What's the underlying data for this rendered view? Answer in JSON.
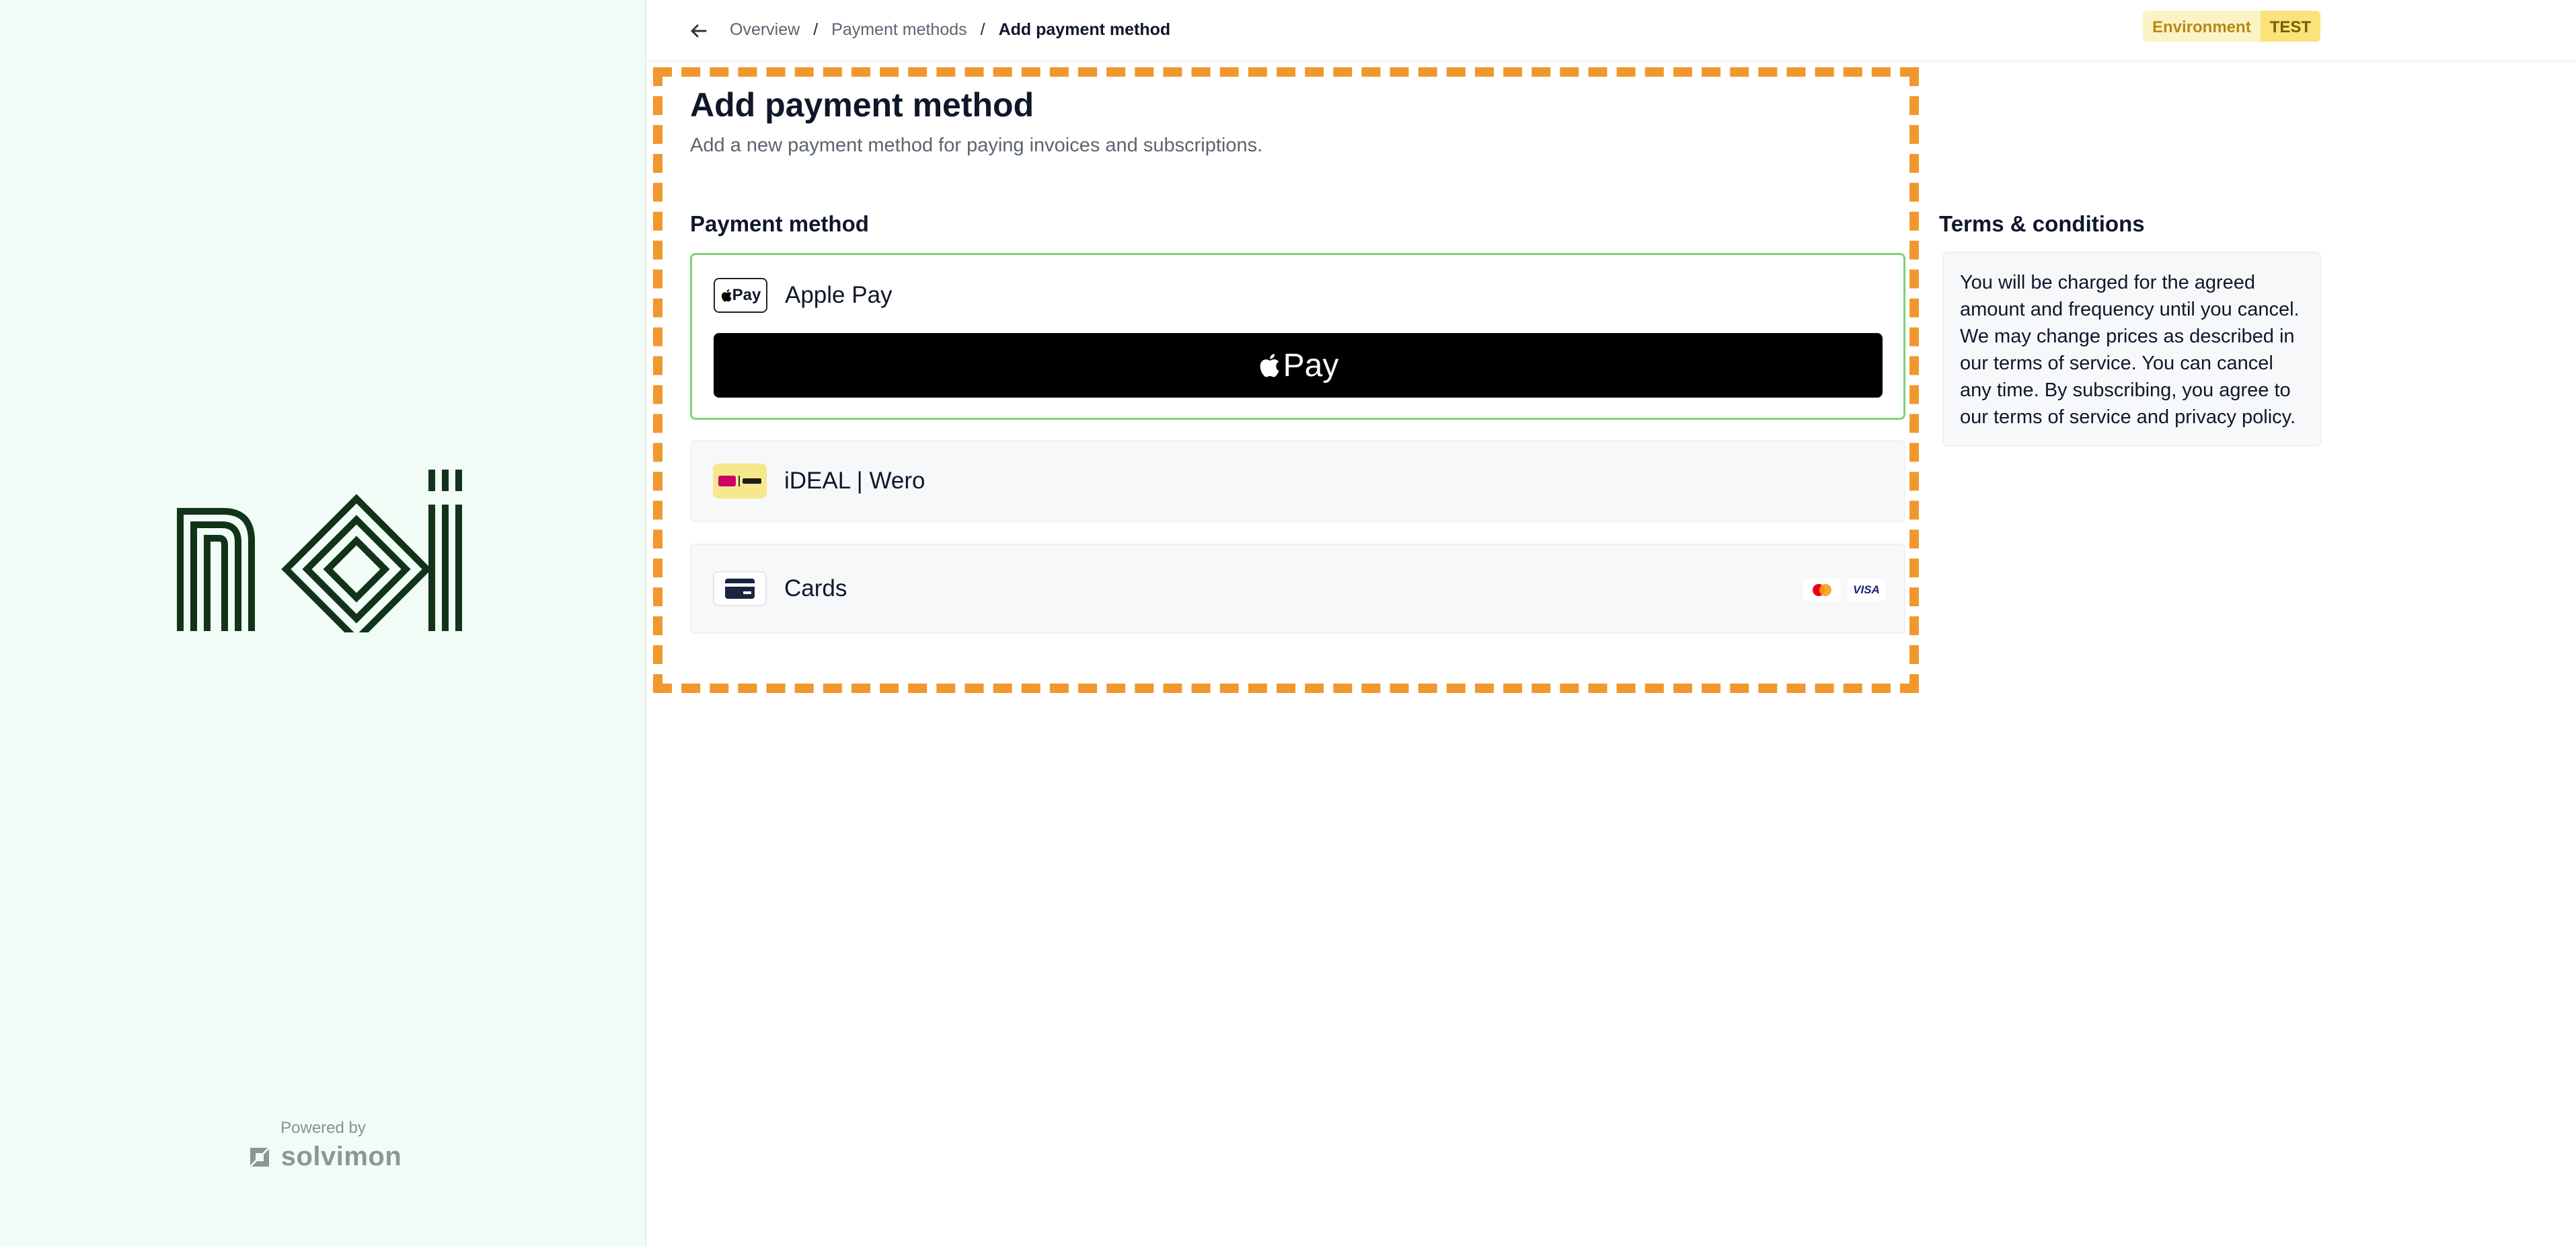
{
  "brand": {
    "logo_text": "noi",
    "powered_by": "Powered by",
    "platform_name": "solvimon"
  },
  "breadcrumb": {
    "items": [
      "Overview",
      "Payment methods",
      "Add payment method"
    ],
    "separator": "/"
  },
  "environment": {
    "label": "Environment",
    "value": "TEST"
  },
  "page": {
    "title": "Add payment method",
    "subtitle": "Add a new payment method for paying invoices and subscriptions."
  },
  "payment": {
    "section_label": "Payment method",
    "methods": [
      {
        "name": "Apple Pay",
        "icon": "apple-pay-icon",
        "selected": true,
        "button_label": "Pay"
      },
      {
        "name": "iDEAL | Wero",
        "icon": "ideal-wero-icon",
        "selected": false
      },
      {
        "name": "Cards",
        "icon": "credit-card-icon",
        "selected": false,
        "brands": [
          "mastercard-icon",
          "VISA"
        ]
      }
    ]
  },
  "terms": {
    "title": "Terms & conditions",
    "body": "You will be charged for the agreed amount and frequency until you cancel. We may change prices as described in our terms of service. You can cancel any time. By subscribing, you agree to our terms of service and privacy policy."
  },
  "colors": {
    "brand_dark_green": "#12331a",
    "left_panel_bg": "#f1fcf6",
    "selected_border": "#7fd17a",
    "focus_outline": "#f0982e",
    "env_badge": "#f9e37a"
  }
}
